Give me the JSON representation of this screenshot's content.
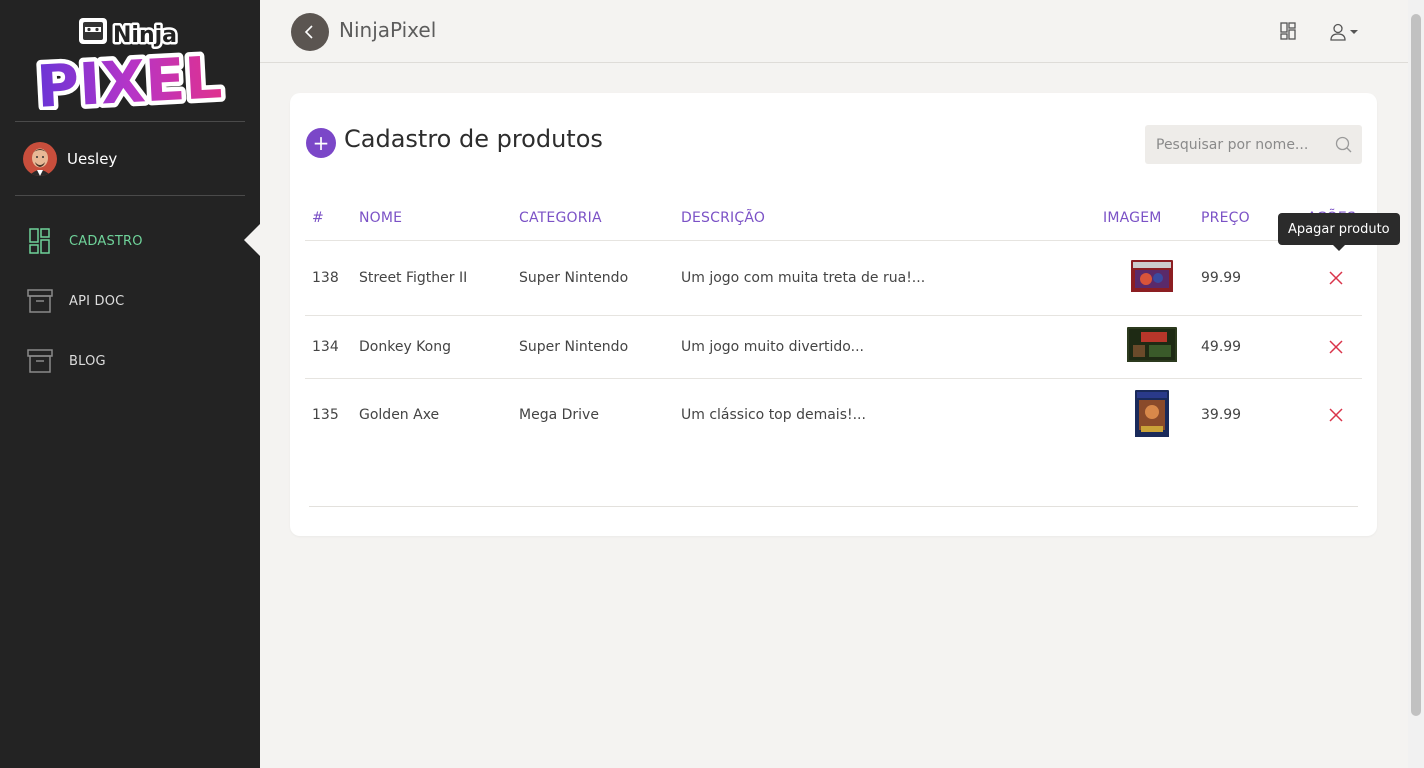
{
  "app": {
    "title": "NinjaPixel",
    "logo_text_top": "Ninja",
    "logo_text_bottom": "PIXEL"
  },
  "sidebar": {
    "user_name": "Uesley",
    "items": [
      {
        "label": "CADASTRO",
        "icon": "dashboard-grid-icon",
        "active": true
      },
      {
        "label": "API DOC",
        "icon": "archive-box-icon",
        "active": false
      },
      {
        "label": "BLOG",
        "icon": "archive-box-icon",
        "active": false
      }
    ]
  },
  "topbar": {
    "grid_icon": "grid-layout-icon",
    "user_icon": "user-icon"
  },
  "page": {
    "title": "Cadastro de produtos",
    "add_label": "+",
    "search_placeholder": "Pesquisar por nome..."
  },
  "table": {
    "columns": [
      "#",
      "NOME",
      "CATEGORIA",
      "DESCRIÇÃO",
      "IMAGEM",
      "PREÇO",
      "AÇÕES"
    ],
    "rows": [
      {
        "id": "138",
        "name": "Street Figther II",
        "category": "Super Nintendo",
        "description": "Um jogo com muita treta de rua!...",
        "price": "99.99"
      },
      {
        "id": "134",
        "name": "Donkey Kong",
        "category": "Super Nintendo",
        "description": "Um jogo muito divertido...",
        "price": "49.99"
      },
      {
        "id": "135",
        "name": "Golden Axe",
        "category": "Mega Drive",
        "description": "Um clássico top demais!...",
        "price": "39.99"
      }
    ]
  },
  "tooltip": {
    "text": "Apagar produto"
  },
  "colors": {
    "accent": "#7b47c8",
    "sidebar_bg": "#232323",
    "active_nav": "#6fd39a",
    "delete": "#d9344a"
  }
}
